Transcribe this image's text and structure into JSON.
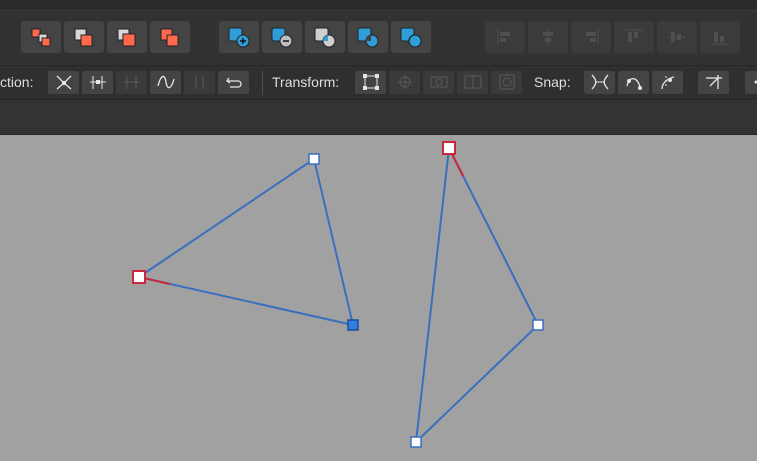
{
  "context_toolbar": {
    "action_label": "ction:",
    "transform_label": "Transform:",
    "snap_label": "Snap:"
  },
  "colors": {
    "canvas": "#a1a1a1",
    "toolbar": "#323232",
    "button": "#444444",
    "accent_orange": "#ff6a4d",
    "accent_blue": "#2f9ed8",
    "path_stroke": "#3a6fbf",
    "node_selected": "#2f7fe0",
    "node_start": "#c8293f"
  },
  "icons": {
    "boolean_ops": [
      "add-icon",
      "subtract-icon",
      "intersect-icon",
      "xor-icon",
      "divide-icon"
    ],
    "geometry_ops": [
      "geometry-add-icon",
      "geometry-subtract-icon",
      "geometry-intersect-icon",
      "geometry-xor-icon",
      "geometry-divide-icon"
    ],
    "align_ops": [
      "align-left-icon",
      "align-center-icon",
      "align-right-icon",
      "align-top-icon",
      "align-middle-icon",
      "align-bottom-icon"
    ]
  }
}
